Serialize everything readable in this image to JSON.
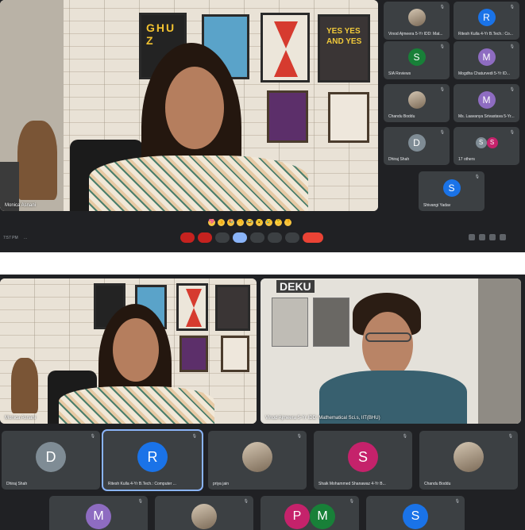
{
  "top_call": {
    "speaker_name": "Monica Asnani",
    "clock": "7:57 PM",
    "meeting_code": "...",
    "participants": [
      {
        "initial": "",
        "name": "Vinod Ajmeera 5-Yr IDD: Mat...",
        "color": "#6d5b48",
        "photo": true
      },
      {
        "initial": "R",
        "name": "Ritesh Kulla 4-Yr B.Tech.: Co...",
        "color": "#1a73e8"
      },
      {
        "initial": "S",
        "name": "SIA Reviews",
        "color": "#188038"
      },
      {
        "initial": "M",
        "name": "Mogdha Chaturvedi 5-Yr ID...",
        "color": "#8e6cc1"
      },
      {
        "initial": "",
        "name": "Chandu Boddu",
        "color": "#7a6a5a",
        "photo": true
      },
      {
        "initial": "M",
        "name": "Ms. Laavanya Srivastava 5-Yr...",
        "color": "#8e6cc1"
      },
      {
        "initial": "D",
        "name": "Dhiraj Shah",
        "color": "#7f8c95"
      },
      {
        "initial": "",
        "name": "17 others",
        "color": "#5f6368",
        "others": true
      },
      {
        "initial": "S",
        "name": "Shivangi Yadav",
        "color": "#1a73e8"
      }
    ],
    "reactions": [
      "💖",
      "👍",
      "🎉",
      "👏",
      "😂",
      "😮",
      "😢",
      "🤔",
      "👎"
    ],
    "posters": {
      "p1": "GHUZ",
      "p4": "YES YES AND YES"
    }
  },
  "bottom_call": {
    "speaker_left_name": "Monica Asnani",
    "speaker_right_name": "Vinod Ajmeera 5-Yr IDD: Mathematical Sci.s, IIT(BHU)",
    "right_poster_text": "DEKU",
    "participants": [
      {
        "initial": "D",
        "name": "Dhiraj Shah",
        "color": "#7f8c95"
      },
      {
        "initial": "R",
        "name": "Ritesh Kulla 4-Yr B.Tech.: Computer ...",
        "color": "#1a73e8",
        "active": true
      },
      {
        "initial": "",
        "name": "priya jain",
        "color": "#6d5b48",
        "photo": true
      },
      {
        "initial": "S",
        "name": "Shaik Mohammed Shanawaz 4-Yr B...",
        "color": "#c5226b"
      },
      {
        "initial": "",
        "name": "Chandu Boddu",
        "color": "#7a6a5a",
        "photo": true
      },
      {
        "initial": "M",
        "name": "",
        "color": "#8e6cc1"
      },
      {
        "initial": "",
        "name": "",
        "color": "#6d5b48",
        "photo": true
      },
      {
        "initial": "P",
        "name": "",
        "color": "#c5226b",
        "pair": "M"
      },
      {
        "initial": "S",
        "name": "",
        "color": "#1a73e8"
      }
    ]
  }
}
